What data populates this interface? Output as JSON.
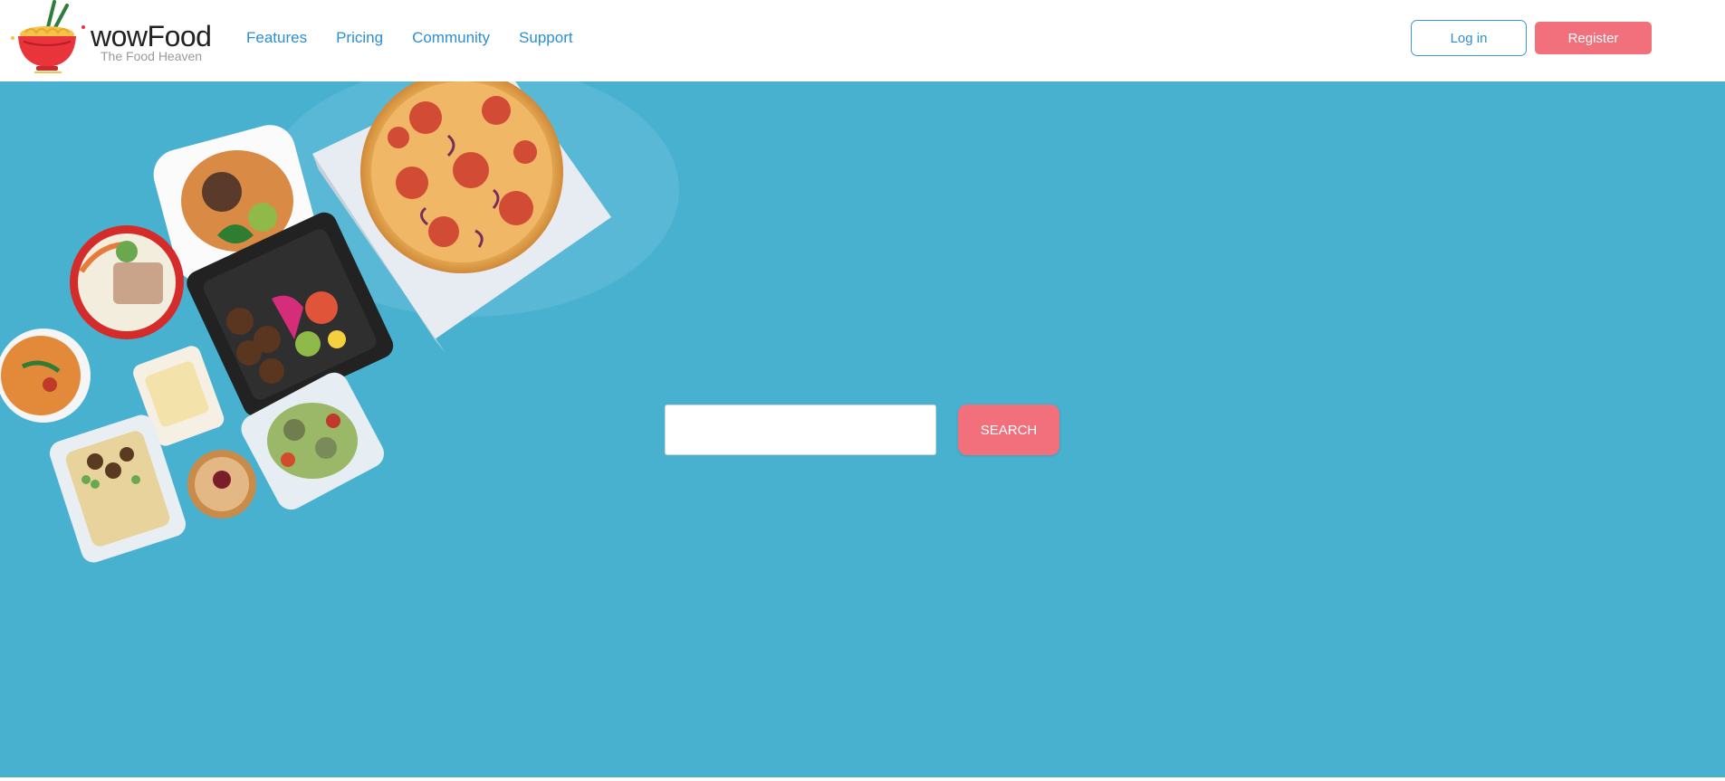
{
  "brand": {
    "name": "wowFood",
    "tagline": "The Food Heaven"
  },
  "nav": {
    "links": [
      "Features",
      "Pricing",
      "Community",
      "Support"
    ]
  },
  "auth": {
    "login_label": "Log in",
    "register_label": "Register"
  },
  "search": {
    "value": "",
    "placeholder": "",
    "button_label": "SEARCH"
  },
  "colors": {
    "hero_background": "#48b1d0",
    "accent": "#f1707c",
    "link": "#2b8fd6"
  },
  "icons": {
    "logo": "noodle-bowl-icon",
    "hero_image": "food-spread-illustration"
  }
}
